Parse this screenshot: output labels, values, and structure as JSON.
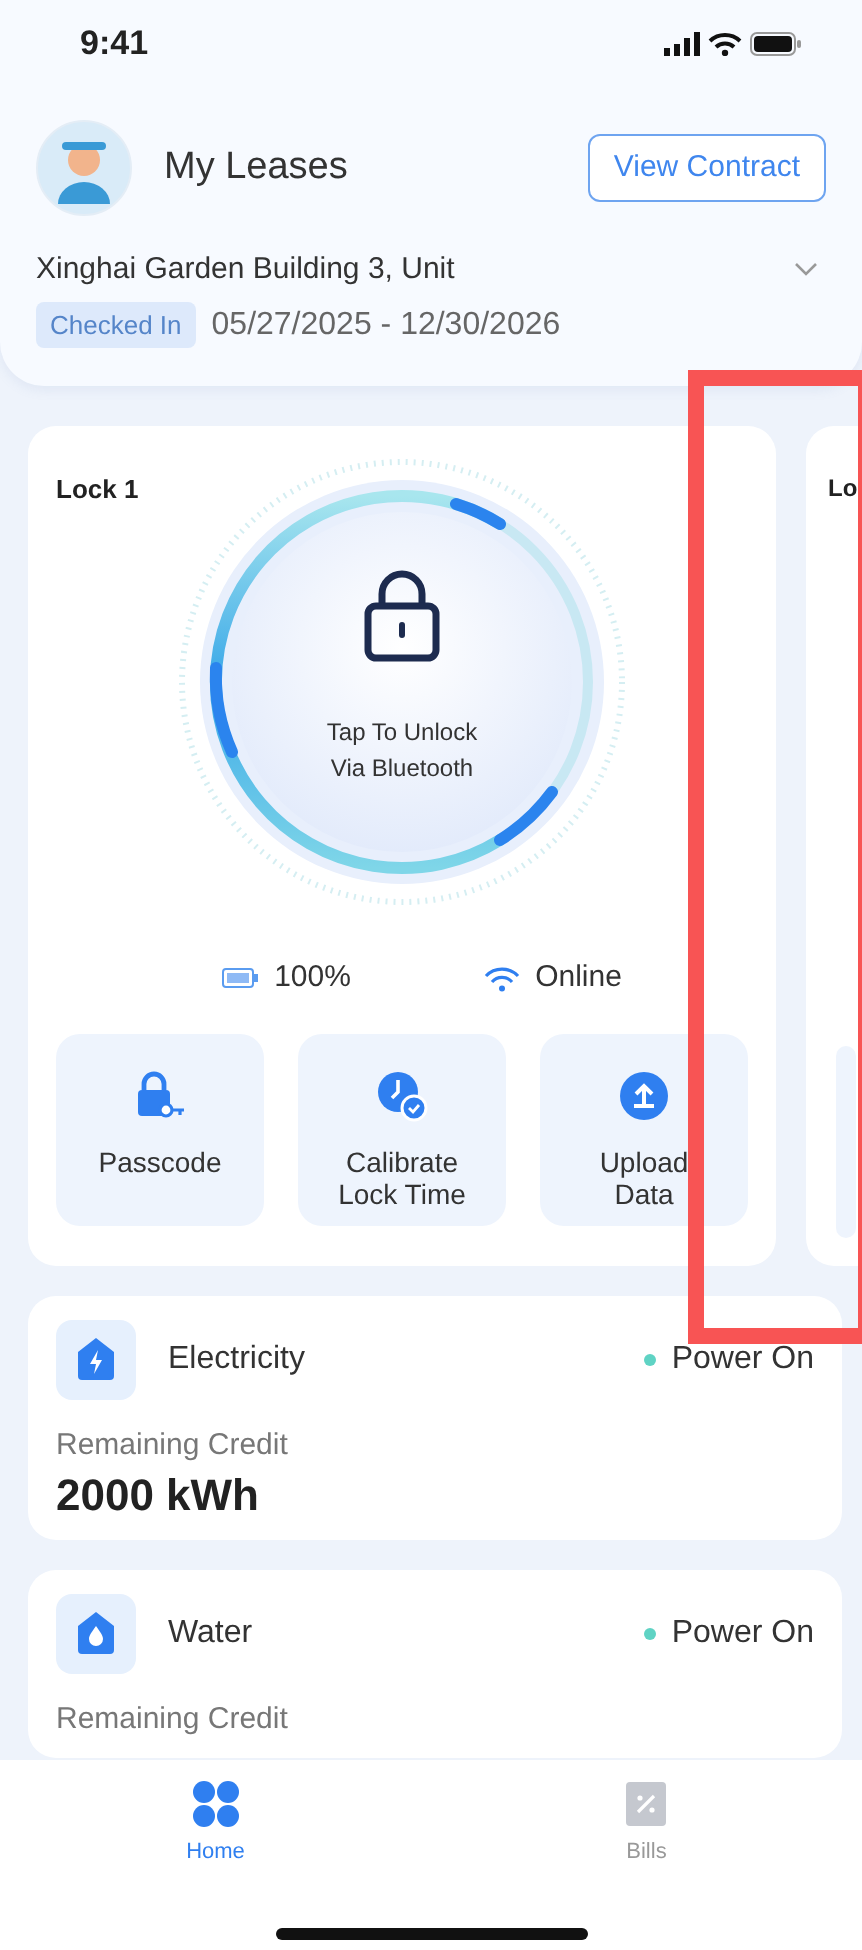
{
  "status_bar": {
    "time": "9:41"
  },
  "header": {
    "title": "My Leases",
    "button": "View Contract",
    "property": "Xinghai Garden Building 3, Unit",
    "status": "Checked In",
    "dates": "05/27/2025 - 12/30/2026"
  },
  "locks": [
    {
      "name": "Lock 1",
      "unlock_lines": [
        "Tap To Unlock",
        "Via Bluetooth"
      ],
      "battery": "100%",
      "connection": "Online",
      "actions": [
        {
          "kind": "passcode",
          "lines": [
            "Passcode"
          ]
        },
        {
          "kind": "calibrate",
          "lines": [
            "Calibrate",
            "Lock Time"
          ]
        },
        {
          "kind": "upload",
          "lines": [
            "Upload",
            "Data"
          ]
        }
      ]
    },
    {
      "name": "Lo"
    }
  ],
  "utilities": [
    {
      "kind": "electricity",
      "name": "Electricity",
      "on": true,
      "status": "Power On",
      "label": "Remaining Credit",
      "value": "2000 kWh"
    },
    {
      "kind": "water",
      "name": "Water",
      "on": true,
      "status": "Power On",
      "label": "Remaining Credit"
    }
  ],
  "tabs": [
    {
      "kind": "home",
      "label": "Home",
      "selected": true
    },
    {
      "kind": "bills",
      "label": "Bills",
      "selected": false
    }
  ]
}
